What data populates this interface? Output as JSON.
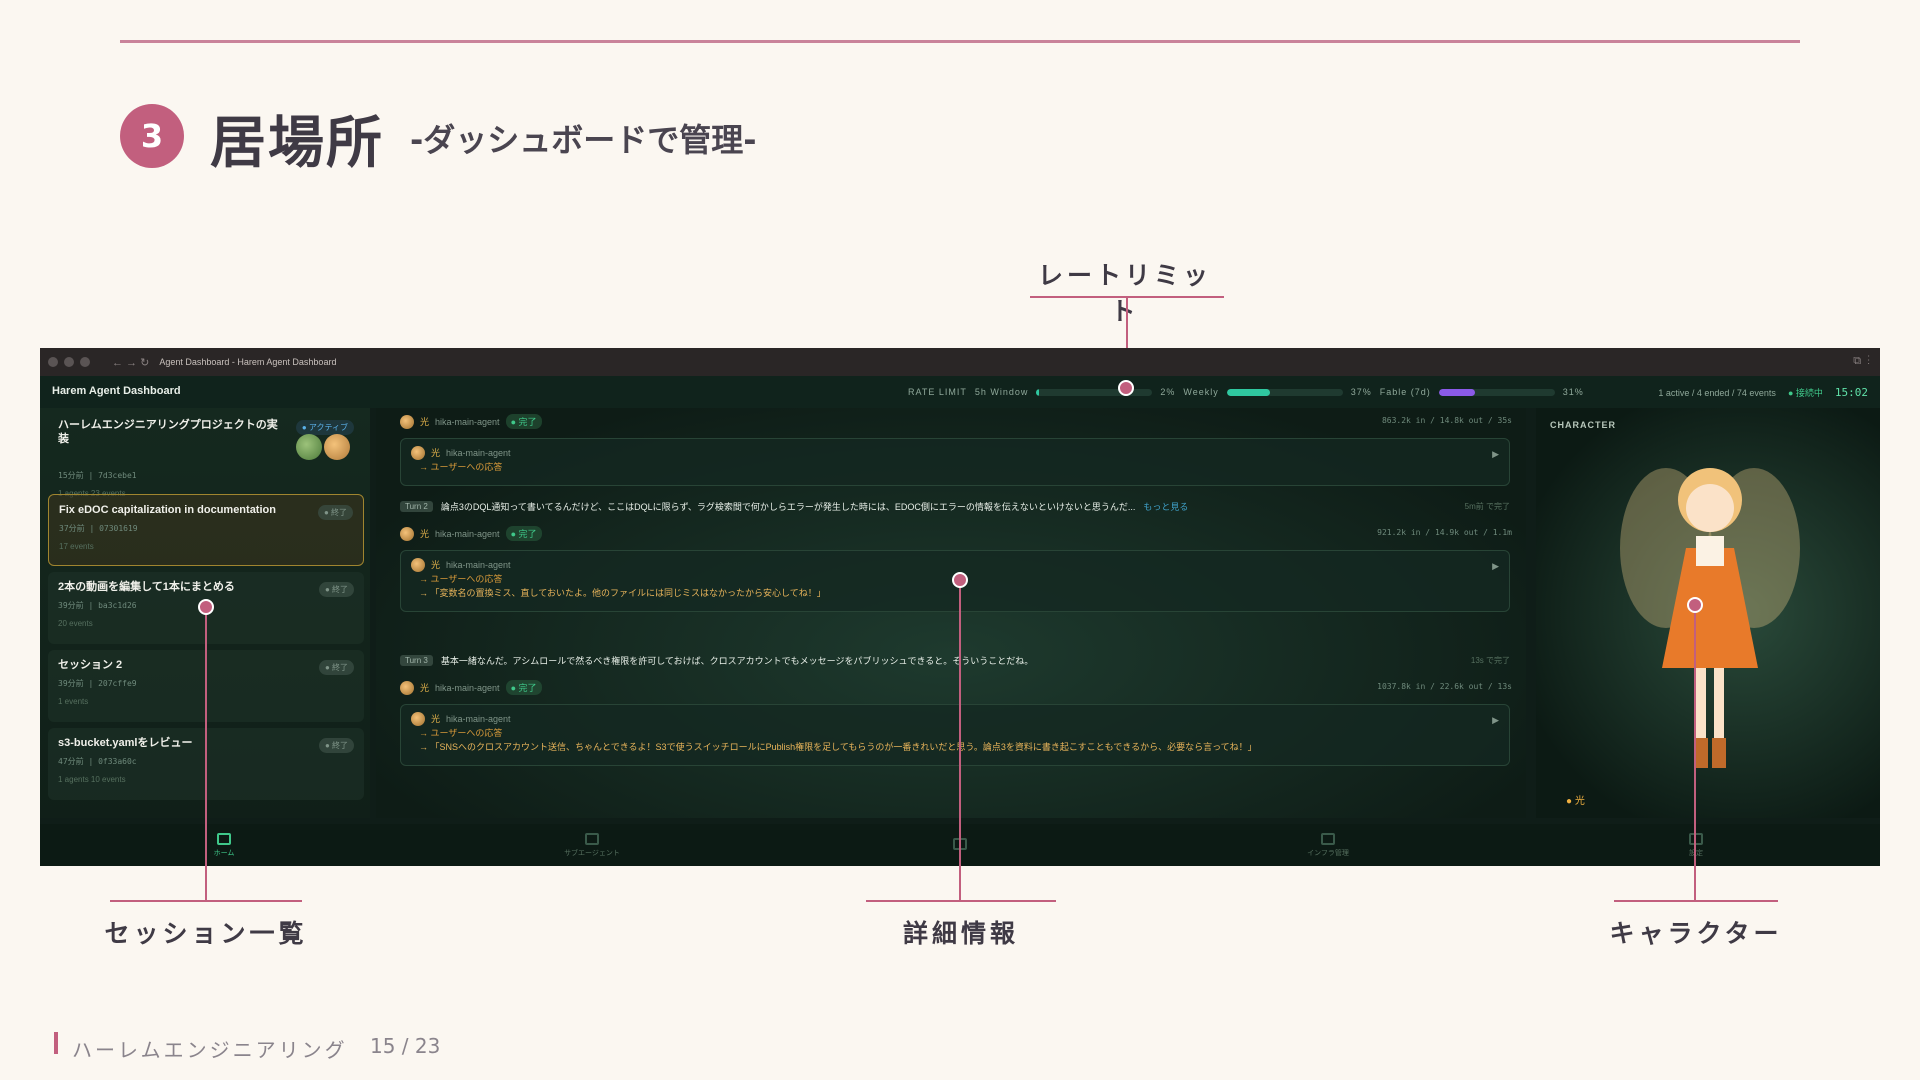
{
  "slide": {
    "number": "3",
    "title": "居場所",
    "subtitle": "-ダッシュボードで管理-",
    "footer": "ハーレムエンジニアリング",
    "page": "15 / 23"
  },
  "callouts": {
    "rate_limit": "レートリミット",
    "session_list": "セッション一覧",
    "details": "詳細情報",
    "character": "キャラクター"
  },
  "window": {
    "title": "Agent Dashboard - Harem Agent Dashboard"
  },
  "appbar": {
    "title": "Harem Agent Dashboard",
    "rate_limit_label": "RATE LIMIT",
    "window_5h_label": "5h Window",
    "window_5h_value": "2%",
    "window_5h_pct": 2,
    "weekly_label": "Weekly",
    "weekly_value": "37%",
    "weekly_pct": 37,
    "fable_label": "Fable (7d)",
    "fable_value": "31%",
    "fable_pct": 31,
    "status": "1 active / 4 ended / 74 events",
    "connection": "● 接続中",
    "clock": "15:02"
  },
  "colors": {
    "accent": "#c25f7e",
    "weekly_bar": "#2fc8a0",
    "fable_bar": "#8a5ae8",
    "window_bar": "#2fc8a0"
  },
  "sessions": [
    {
      "title": "ハーレムエンジニアリングプロジェクトの実装",
      "badge": "● アクティブ",
      "meta": "15分前 | 7d3cebe1",
      "events": "1 agents  23 events"
    },
    {
      "title": "Fix eDOC capitalization in documentation",
      "badge": "● 終了",
      "meta": "37分前 | 07301619",
      "events": "17 events"
    },
    {
      "title": "2本の動画を編集して1本にまとめる",
      "badge": "● 終了",
      "meta": "39分前 | ba3c1d26",
      "events": "20 events"
    },
    {
      "title": "セッション 2",
      "badge": "● 終了",
      "meta": "39分前 | 207cffe9",
      "events": "1 events"
    },
    {
      "title": "s3-bucket.yamlをレビュー",
      "badge": "● 終了",
      "meta": "47分前 | 0f33a60c",
      "events": "1 agents  10 events"
    }
  ],
  "messages": {
    "agent_name": "光",
    "agent_id": "hika-main-agent",
    "done": "● 完了",
    "reply_label": "→ ユーザーへの応答",
    "block1_stats": "863.2k in / 14.8k out / 35s",
    "turn2_tag": "Turn 2",
    "turn2_text": "論点3のDQL通知って書いてるんだけど、ここはDQLに限らず、ラグ検索間で何かしらエラーが発生した時には、EDOC側にエラーの情報を伝えないといけないと思うんだ...",
    "turn2_more": "もっと見る",
    "turn2_time": "5m前 で完了",
    "block2_stats": "921.2k in / 14.9k out / 1.1m",
    "block2_quote": "→ 「変数名の置換ミス、直しておいたよ。他のファイルには同じミスはなかったから安心してね！」",
    "turn3_tag": "Turn 3",
    "turn3_text": "基本一緒なんだ。アシムロールで然るべき権限を許可しておけば、クロスアカウントでもメッセージをパブリッシュできると。そういうことだね。",
    "turn3_time": "13s で完了",
    "block3_stats": "1037.8k in / 22.6k out / 13s",
    "block3_quote": "→ 「SNSへのクロスアカウント送信、ちゃんとできるよ！S3で使うスイッチロールにPublish権限を足してもらうのが一番きれいだと思う。論点3を資料に書き起こすこともできるから、必要なら言ってね！」"
  },
  "character": {
    "label": "CHARACTER",
    "name": "● 光"
  },
  "nav": [
    {
      "label": "ホーム"
    },
    {
      "label": "サブエージェント"
    },
    {
      "label": ""
    },
    {
      "label": "インフラ管理"
    },
    {
      "label": "設定"
    }
  ]
}
